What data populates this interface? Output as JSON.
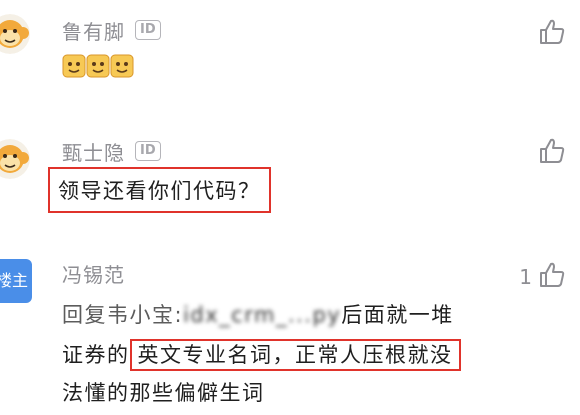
{
  "comments": [
    {
      "username": "鲁有脚",
      "id_badge": "ID",
      "emoji_count": 3
    },
    {
      "username": "甄士隐",
      "id_badge": "ID",
      "text": "领导还看你们代码？"
    },
    {
      "username": "冯锡范",
      "author_badge": "楼主",
      "like_count": "1",
      "line1_prefix": "回复韦小宝:",
      "line1_obscured": "idx_crm_...py",
      "line1_suffix": "后面就一堆",
      "line2_prefix": "证券的",
      "line2_highlight": "英文专业名词，正常人压根就没",
      "line3": "法懂的那些偏僻生词"
    }
  ],
  "colors": {
    "highlight_border": "#e0332b",
    "author_badge_bg": "#4a8ee8",
    "meta_text": "#8e8e93"
  }
}
